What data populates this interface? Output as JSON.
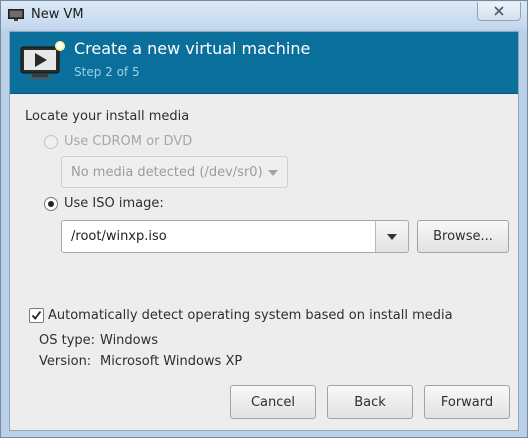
{
  "window": {
    "title": "New VM",
    "close_icon": "close-icon",
    "app_icon": "vm-monitor-icon"
  },
  "header": {
    "title": "Create a new virtual machine",
    "step": "Step 2 of 5",
    "icon": "vm-wizard-icon",
    "band_color": "#0b6f9c"
  },
  "media": {
    "section_label": "Locate your install media",
    "cdrom_label": "Use CDROM or DVD",
    "cdrom_selected": false,
    "cdrom_enabled": false,
    "cdrom_device": "No media detected (/dev/sr0)",
    "iso_label": "Use ISO image:",
    "iso_selected": true,
    "iso_path": "/root/winxp.iso",
    "browse_label": "Browse..."
  },
  "os_detect": {
    "checkbox_label": "Automatically detect operating system based on install media",
    "checked": true,
    "os_type_label": "OS type:",
    "os_type_value": "Windows",
    "version_label": "Version:",
    "version_value": "Microsoft Windows XP"
  },
  "buttons": {
    "cancel": "Cancel",
    "back": "Back",
    "forward": "Forward"
  }
}
